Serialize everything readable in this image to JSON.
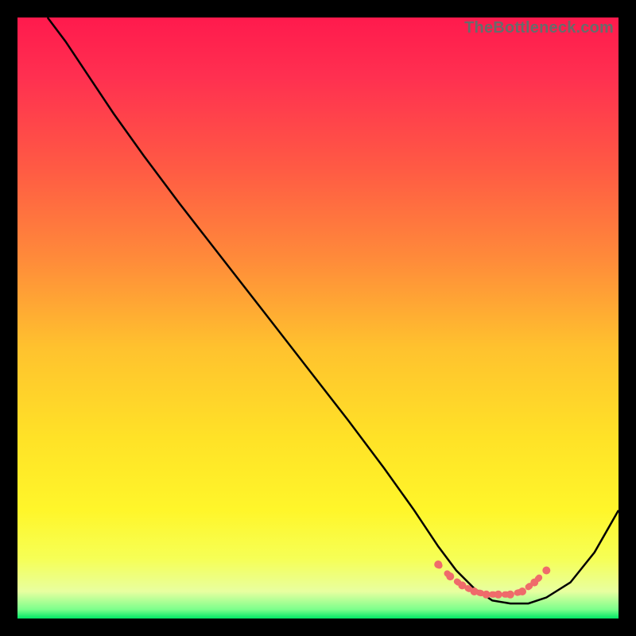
{
  "watermark": "TheBottleneck.com",
  "gradient_stops": [
    {
      "offset": 0.0,
      "color": "#ff1a4d"
    },
    {
      "offset": 0.1,
      "color": "#ff3050"
    },
    {
      "offset": 0.25,
      "color": "#ff5a44"
    },
    {
      "offset": 0.4,
      "color": "#ff8a3a"
    },
    {
      "offset": 0.55,
      "color": "#ffc22e"
    },
    {
      "offset": 0.7,
      "color": "#ffe227"
    },
    {
      "offset": 0.82,
      "color": "#fff62a"
    },
    {
      "offset": 0.9,
      "color": "#f6ff55"
    },
    {
      "offset": 0.955,
      "color": "#e8ffa0"
    },
    {
      "offset": 0.985,
      "color": "#7cff8c"
    },
    {
      "offset": 1.0,
      "color": "#00e765"
    }
  ],
  "chart_data": {
    "type": "line",
    "title": "",
    "xlabel": "",
    "ylabel": "",
    "xlim": [
      0,
      100
    ],
    "ylim": [
      0,
      100
    ],
    "series": [
      {
        "name": "bottleneck-curve",
        "color": "#000000",
        "x": [
          5,
          8,
          12,
          16,
          21,
          27,
          34,
          41,
          48,
          55,
          61,
          66,
          70,
          73,
          76,
          79,
          82,
          85,
          88,
          92,
          96,
          100
        ],
        "y": [
          100,
          96,
          90,
          84,
          77,
          69,
          60,
          51,
          42,
          33,
          25,
          18,
          12,
          8,
          5,
          3,
          2.5,
          2.5,
          3.5,
          6,
          11,
          18
        ]
      },
      {
        "name": "optimal-band",
        "color": "#ef6b6b",
        "style": "dotted",
        "x": [
          70,
          72,
          74,
          76,
          78,
          80,
          82,
          84,
          86,
          88
        ],
        "y": [
          9,
          7,
          5.5,
          4.5,
          4,
          4,
          4,
          4.5,
          6,
          8
        ]
      }
    ]
  }
}
